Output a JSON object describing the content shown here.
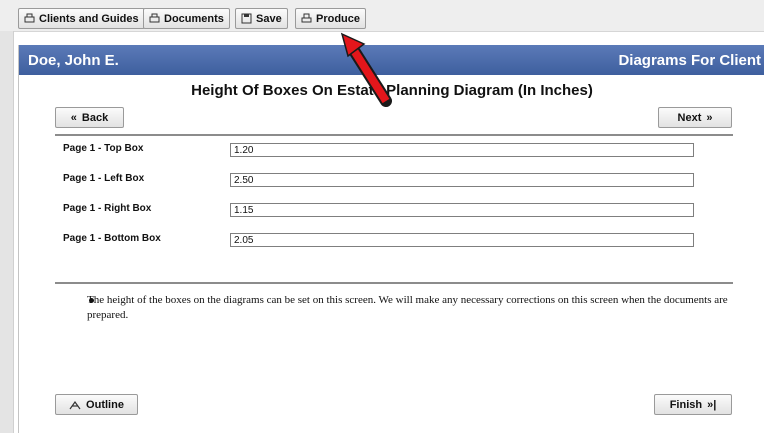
{
  "toolbar": {
    "buttons": [
      {
        "label": "Clients and Guides",
        "icon": "clients-icon"
      },
      {
        "label": "Documents",
        "icon": "documents-icon"
      },
      {
        "label": "Save",
        "icon": "save-icon"
      },
      {
        "label": "Produce",
        "icon": "produce-icon"
      }
    ]
  },
  "header": {
    "client_name": "Doe, John E.",
    "section_title": "Diagrams For Client",
    "color": "#4a6aa8"
  },
  "page": {
    "heading": "Height Of Boxes On Estate Planning Diagram (In Inches)",
    "back_label": "Back",
    "next_label": "Next",
    "outline_label": "Outline",
    "finish_label": "Finish"
  },
  "fields": [
    {
      "label": "Page 1 - Top Box",
      "value": "1.20"
    },
    {
      "label": "Page 1 - Left Box",
      "value": "2.50"
    },
    {
      "label": "Page 1 - Right Box",
      "value": "1.15"
    },
    {
      "label": "Page 1 - Bottom Box",
      "value": "2.05"
    }
  ],
  "note": "The height of the boxes on the diagrams can be set on this screen. We will make any necessary corrections on this screen when the documents are prepared.",
  "annotation": {
    "arrow_color": "#e3161b",
    "points_to": "Produce"
  }
}
